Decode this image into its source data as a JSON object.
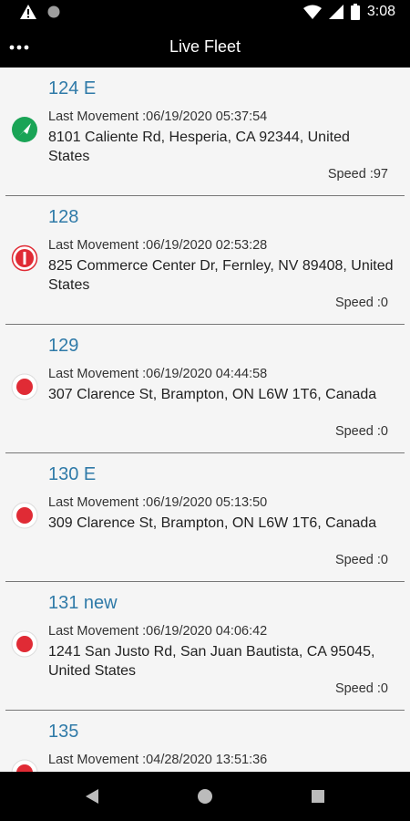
{
  "status_bar": {
    "time": "3:08"
  },
  "app_bar": {
    "title": "Live Fleet"
  },
  "vehicles": [
    {
      "name": "124 E",
      "last_movement": "Last Movement :06/19/2020 05:37:54",
      "address": "8101 Caliente Rd, Hesperia, CA 92344, United States",
      "speed": "Speed :97",
      "status": "moving"
    },
    {
      "name": "128",
      "last_movement": "Last Movement :06/19/2020 02:53:28",
      "address": "825 Commerce Center Dr, Fernley, NV 89408, United States",
      "speed": "Speed :0",
      "status": "stopped-idle"
    },
    {
      "name": "129",
      "last_movement": "Last Movement :06/19/2020 04:44:58",
      "address": "307 Clarence St, Brampton, ON L6W 1T6, Canada",
      "speed": "Speed :0",
      "status": "stopped"
    },
    {
      "name": "130 E",
      "last_movement": "Last Movement :06/19/2020 05:13:50",
      "address": "309 Clarence St, Brampton, ON L6W 1T6, Canada",
      "speed": "Speed :0",
      "status": "stopped"
    },
    {
      "name": "131 new",
      "last_movement": "Last Movement :06/19/2020 04:06:42",
      "address": "1241 San Justo Rd, San Juan Bautista, CA 95045, United States",
      "speed": "Speed :0",
      "status": "stopped"
    },
    {
      "name": "135",
      "last_movement": "Last Movement :04/28/2020 13:51:36",
      "address": "",
      "speed": "",
      "status": "stopped"
    }
  ],
  "colors": {
    "accent": "#2f7aa8",
    "moving": "#1aa456",
    "stopped": "#e02b35"
  }
}
